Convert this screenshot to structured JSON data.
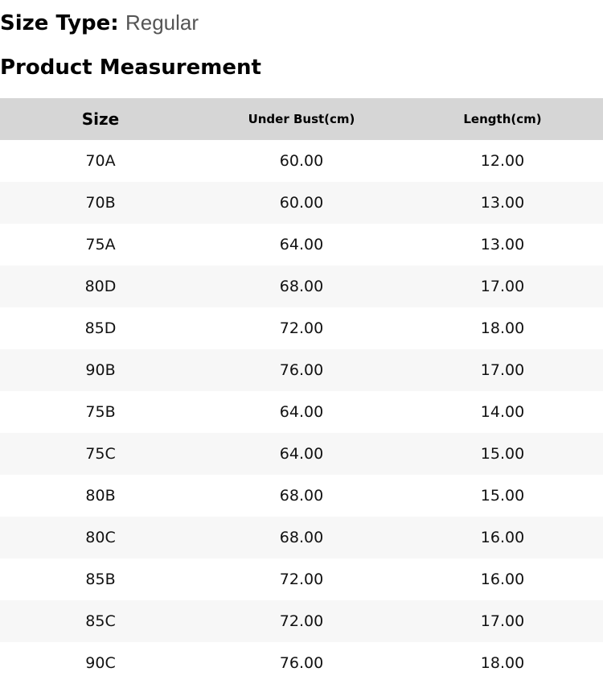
{
  "size_type": {
    "label": "Size Type:",
    "value": "Regular"
  },
  "section_title": "Product Measurement",
  "table": {
    "columns": [
      "Size",
      "Under Bust(cm)",
      "Length(cm)"
    ],
    "rows": [
      [
        "70A",
        "60.00",
        "12.00"
      ],
      [
        "70B",
        "60.00",
        "13.00"
      ],
      [
        "75A",
        "64.00",
        "13.00"
      ],
      [
        "80D",
        "68.00",
        "17.00"
      ],
      [
        "85D",
        "72.00",
        "18.00"
      ],
      [
        "90B",
        "76.00",
        "17.00"
      ],
      [
        "75B",
        "64.00",
        "14.00"
      ],
      [
        "75C",
        "64.00",
        "15.00"
      ],
      [
        "80B",
        "68.00",
        "15.00"
      ],
      [
        "80C",
        "68.00",
        "16.00"
      ],
      [
        "85B",
        "72.00",
        "16.00"
      ],
      [
        "85C",
        "72.00",
        "17.00"
      ],
      [
        "90C",
        "76.00",
        "18.00"
      ]
    ]
  }
}
